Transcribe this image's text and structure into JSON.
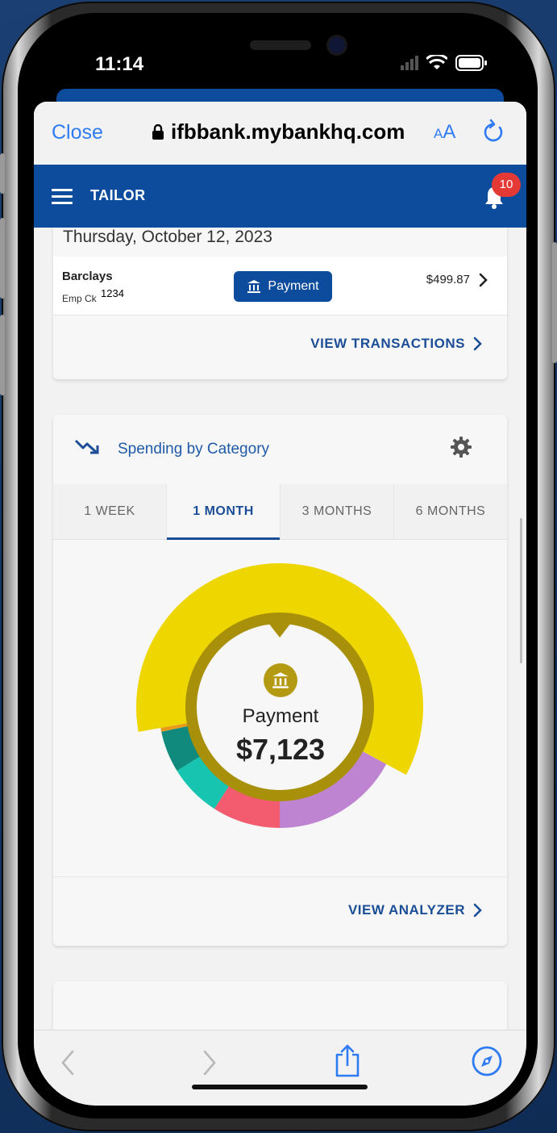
{
  "status_bar": {
    "time": "11:14"
  },
  "browser": {
    "close_label": "Close",
    "url": "ifbbank.mybankhq.com",
    "text_size_label": "AA"
  },
  "header": {
    "brand": "TAILOR",
    "notification_count": "10"
  },
  "transactions_card": {
    "date": "Thursday, October 12, 2023",
    "transaction": {
      "name": "Barclays",
      "account_label": "Emp Ck",
      "account_number": "1234",
      "type_label": "Payment",
      "amount": "$499.87"
    },
    "view_link": "VIEW TRANSACTIONS"
  },
  "spending_card": {
    "title": "Spending by Category",
    "tabs": [
      "1 WEEK",
      "1 MONTH",
      "3 MONTHS",
      "6 MONTHS"
    ],
    "active_tab": "1 MONTH",
    "center_label": "Payment",
    "center_value": "$7,123",
    "view_link": "VIEW ANALYZER"
  },
  "chart_data": {
    "type": "pie",
    "categories": [
      "Payment",
      "Purple",
      "Red",
      "Teal",
      "Dark Teal",
      "Orange"
    ],
    "values": [
      60,
      17,
      9,
      7,
      5.5,
      0.5
    ],
    "colors": [
      "#eed600",
      "#bf84d1",
      "#f25c6e",
      "#16c4b0",
      "#0f8a7c",
      "#e79a1a"
    ]
  },
  "colors": {
    "brand_blue": "#0d4c9c",
    "link_blue": "#2f7bf4",
    "badge_red": "#e53935"
  }
}
